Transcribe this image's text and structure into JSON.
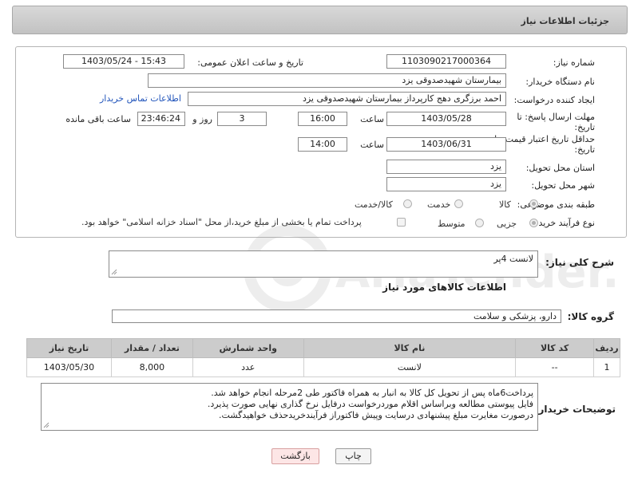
{
  "header": {
    "title": "جزئیات اطلاعات نیاز"
  },
  "form": {
    "need_number": {
      "label": "شماره نیاز:",
      "value": "1103090217000364"
    },
    "announce_datetime": {
      "label": "تاریخ و ساعت اعلان عمومی:",
      "value": "1403/05/24 - 15:43"
    },
    "buyer_org": {
      "label": "نام دستگاه خریدار:",
      "value": "بیمارستان شهیدصدوقی یزد"
    },
    "requester": {
      "label": "ایجاد کننده درخواست:",
      "value": "احمد برزگری دهج کارپرداز بیمارستان شهیدصدوقی یزد",
      "contact_link": "اطلاعات تماس خریدار"
    },
    "reply_deadline": {
      "label_line1": "مهلت ارسال پاسخ: تا",
      "label_line2": "تاریخ:",
      "date": "1403/05/28",
      "time_label": "ساعت",
      "time": "16:00",
      "days": "3",
      "days_label": "روز و",
      "remaining": "23:46:24",
      "remaining_label": "ساعت باقی مانده"
    },
    "price_validity": {
      "label_line1": "حداقل تاریخ اعتبار قیمت: تا",
      "label_line2": "تاریخ:",
      "date": "1403/06/31",
      "time_label": "ساعت",
      "time": "14:00"
    },
    "delivery_province": {
      "label": "استان محل تحویل:",
      "value": "یزد"
    },
    "delivery_city": {
      "label": "شهر محل تحویل:",
      "value": "یزد"
    },
    "category": {
      "label": "طبقه بندی موضوعی:",
      "options": [
        "کالا",
        "خدمت",
        "کالا/خدمت"
      ],
      "selected": "کالا"
    },
    "process_type": {
      "label": "نوع فرآیند خرید :",
      "options": [
        "جزیی",
        "متوسط"
      ],
      "selected": "جزیی",
      "checkbox_text": "پرداخت تمام یا بخشی از مبلغ خرید،از محل \"اسناد خزانه اسلامی\" خواهد بود."
    }
  },
  "description": {
    "label": "شرح کلی نیاز:",
    "value": "لانست 4پر"
  },
  "goods_section": {
    "title": "اطلاعات کالاهای مورد نیاز"
  },
  "goods_group": {
    "label": "گروه کالا:",
    "value": "دارو، پزشکی و سلامت"
  },
  "table": {
    "headers": [
      "ردیف",
      "کد کالا",
      "نام کالا",
      "واحد شمارش",
      "تعداد / مقدار",
      "تاریخ نیاز"
    ],
    "rows": [
      [
        "1",
        "--",
        "لانست",
        "عدد",
        "8,000",
        "1403/05/30"
      ]
    ]
  },
  "buyer_notes": {
    "label": "توضیحات خریدار:",
    "lines": [
      "پرداخت6ماه پس از تحویل کل کالا به انبار به همراه فاکتور طی 2مرحله انجام خواهد شد.",
      "فایل پیوستی مطالعه وبراساس اقلام موردرخواست درفایل نرخ گذاری نهایی  صورت پذیرد.",
      "درصورت مغایرت مبلغ پیشنهادی درسایت وپیش فاکتوراز فرآیندخریدحذف خواهیدگشت."
    ]
  },
  "buttons": {
    "print": "چاپ",
    "back": "بازگشت"
  },
  "watermark": {
    "text": "AriaTender.neT"
  }
}
